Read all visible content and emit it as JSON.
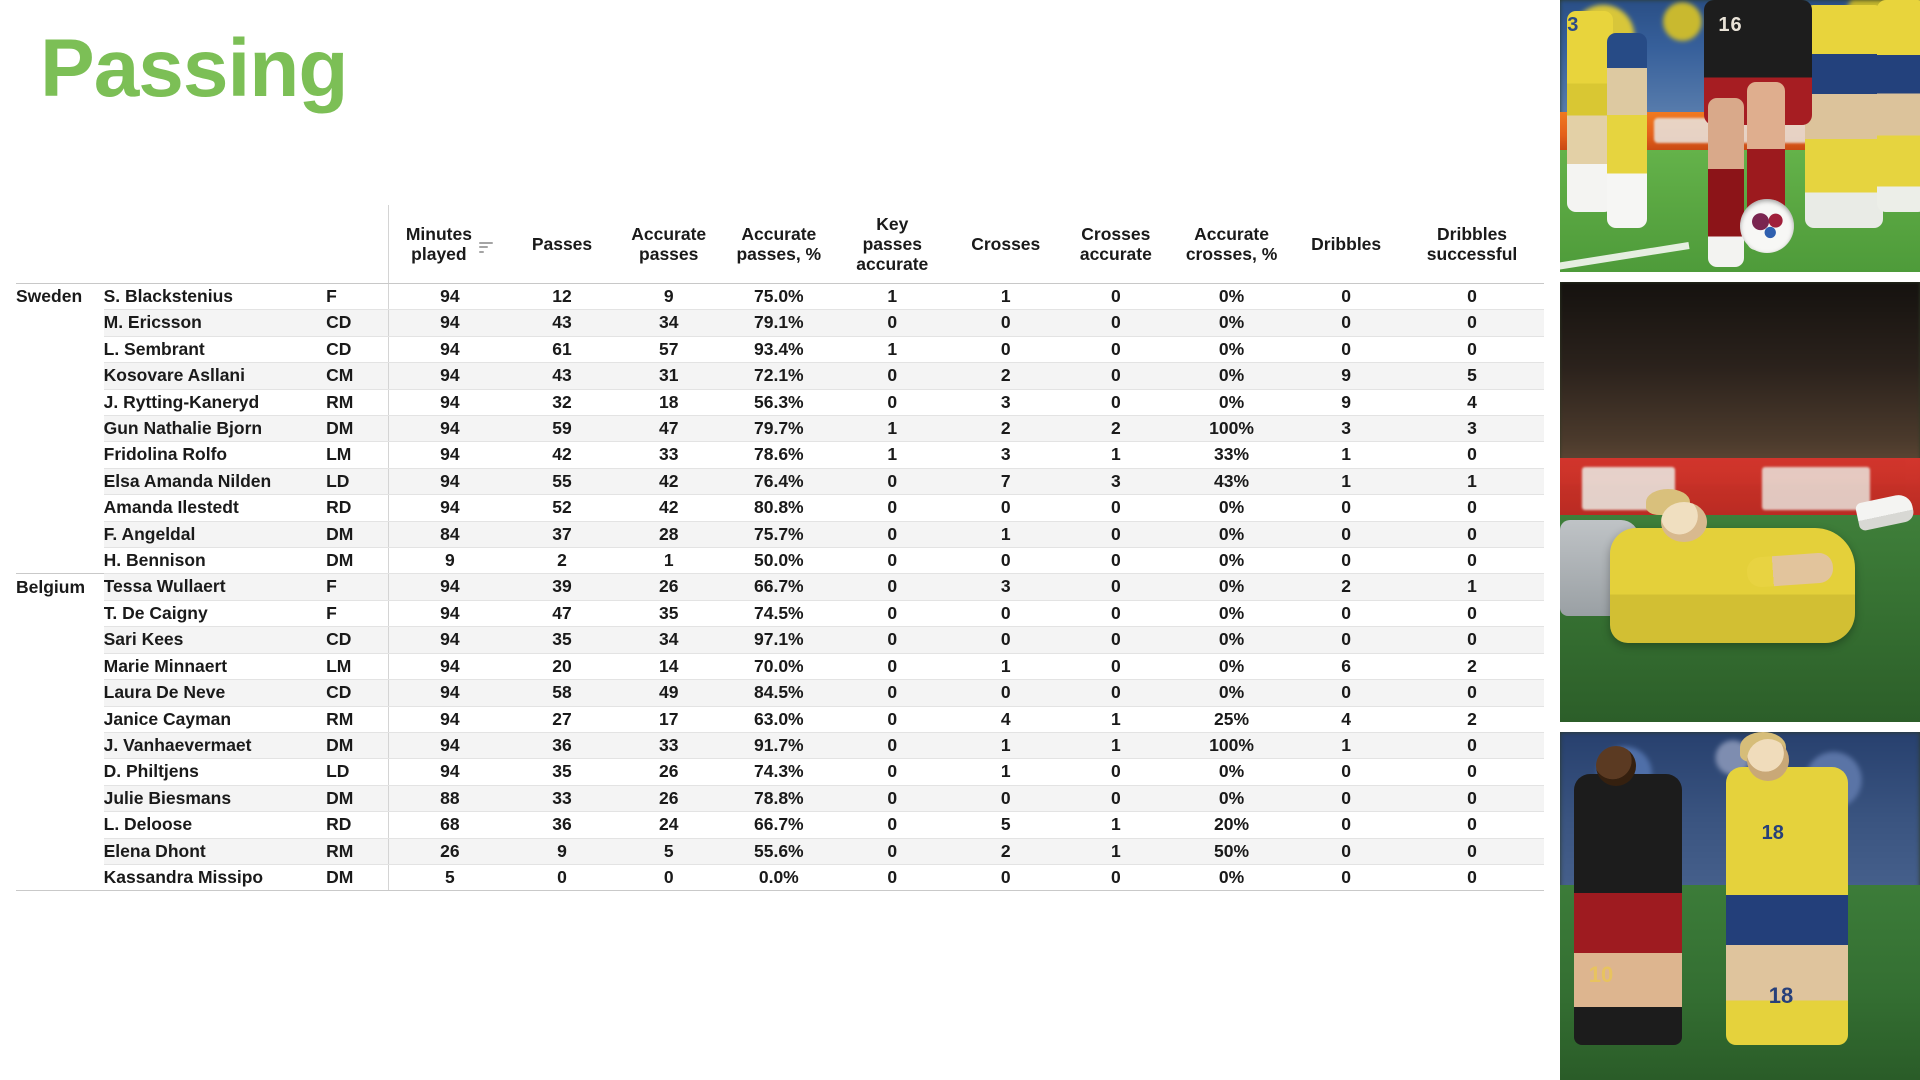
{
  "title": "Passing",
  "accent_color": "#7cbf56",
  "table": {
    "columns": [
      {
        "key": "team",
        "label": ""
      },
      {
        "key": "player",
        "label": ""
      },
      {
        "key": "pos",
        "label": ""
      },
      {
        "key": "minutes",
        "label": "Minutes played",
        "sort_icon": "sort-descending-icon",
        "sorted": true
      },
      {
        "key": "passes",
        "label": "Passes"
      },
      {
        "key": "acc",
        "label": "Accurate passes"
      },
      {
        "key": "accpct",
        "label": "Accurate passes, %"
      },
      {
        "key": "key",
        "label": "Key passes accurate"
      },
      {
        "key": "crosses",
        "label": "Crosses"
      },
      {
        "key": "crossacc",
        "label": "Crosses accurate"
      },
      {
        "key": "crosspct",
        "label": "Accurate crosses, %"
      },
      {
        "key": "dribbles",
        "label": "Dribbles"
      },
      {
        "key": "dribsucc",
        "label": "Dribbles successful"
      }
    ],
    "header_lines": {
      "minutes": [
        "Minutes",
        "played"
      ],
      "passes": [
        "Passes"
      ],
      "acc": [
        "Accurate",
        "passes"
      ],
      "accpct": [
        "Accurate",
        "passes, %"
      ],
      "key": [
        "Key",
        "passes",
        "accurate"
      ],
      "crosses": [
        "Crosses"
      ],
      "crossacc": [
        "Crosses",
        "accurate"
      ],
      "crosspct": [
        "Accurate",
        "crosses, %"
      ],
      "dribbles": [
        "Dribbles"
      ],
      "dribsucc": [
        "Dribbles",
        "successful"
      ]
    },
    "teams": [
      "Sweden",
      "Belgium"
    ],
    "rows": [
      {
        "team": "Sweden",
        "player": "S. Blackstenius",
        "pos": "F",
        "minutes": "94",
        "passes": "12",
        "acc": "9",
        "accpct": "75.0%",
        "key": "1",
        "crosses": "1",
        "crossacc": "0",
        "crosspct": "0%",
        "dribbles": "0",
        "dribsucc": "0"
      },
      {
        "team": "",
        "player": "M. Ericsson",
        "pos": "CD",
        "minutes": "94",
        "passes": "43",
        "acc": "34",
        "accpct": "79.1%",
        "key": "0",
        "crosses": "0",
        "crossacc": "0",
        "crosspct": "0%",
        "dribbles": "0",
        "dribsucc": "0"
      },
      {
        "team": "",
        "player": "L. Sembrant",
        "pos": "CD",
        "minutes": "94",
        "passes": "61",
        "acc": "57",
        "accpct": "93.4%",
        "key": "1",
        "crosses": "0",
        "crossacc": "0",
        "crosspct": "0%",
        "dribbles": "0",
        "dribsucc": "0"
      },
      {
        "team": "",
        "player": "Kosovare Asllani",
        "pos": "CM",
        "minutes": "94",
        "passes": "43",
        "acc": "31",
        "accpct": "72.1%",
        "key": "0",
        "crosses": "2",
        "crossacc": "0",
        "crosspct": "0%",
        "dribbles": "9",
        "dribsucc": "5"
      },
      {
        "team": "",
        "player": "J. Rytting-Kaneryd",
        "pos": "RM",
        "minutes": "94",
        "passes": "32",
        "acc": "18",
        "accpct": "56.3%",
        "key": "0",
        "crosses": "3",
        "crossacc": "0",
        "crosspct": "0%",
        "dribbles": "9",
        "dribsucc": "4"
      },
      {
        "team": "",
        "player": "Gun Nathalie Bjorn",
        "pos": "DM",
        "minutes": "94",
        "passes": "59",
        "acc": "47",
        "accpct": "79.7%",
        "key": "1",
        "crosses": "2",
        "crossacc": "2",
        "crosspct": "100%",
        "dribbles": "3",
        "dribsucc": "3"
      },
      {
        "team": "",
        "player": "Fridolina Rolfo",
        "pos": "LM",
        "minutes": "94",
        "passes": "42",
        "acc": "33",
        "accpct": "78.6%",
        "key": "1",
        "crosses": "3",
        "crossacc": "1",
        "crosspct": "33%",
        "dribbles": "1",
        "dribsucc": "0"
      },
      {
        "team": "",
        "player": "Elsa Amanda Nilden",
        "pos": "LD",
        "minutes": "94",
        "passes": "55",
        "acc": "42",
        "accpct": "76.4%",
        "key": "0",
        "crosses": "7",
        "crossacc": "3",
        "crosspct": "43%",
        "dribbles": "1",
        "dribsucc": "1"
      },
      {
        "team": "",
        "player": "Amanda Ilestedt",
        "pos": "RD",
        "minutes": "94",
        "passes": "52",
        "acc": "42",
        "accpct": "80.8%",
        "key": "0",
        "crosses": "0",
        "crossacc": "0",
        "crosspct": "0%",
        "dribbles": "0",
        "dribsucc": "0"
      },
      {
        "team": "",
        "player": "F. Angeldal",
        "pos": "DM",
        "minutes": "84",
        "passes": "37",
        "acc": "28",
        "accpct": "75.7%",
        "key": "0",
        "crosses": "1",
        "crossacc": "0",
        "crosspct": "0%",
        "dribbles": "0",
        "dribsucc": "0"
      },
      {
        "team": "",
        "player": "H. Bennison",
        "pos": "DM",
        "minutes": "9",
        "passes": "2",
        "acc": "1",
        "accpct": "50.0%",
        "key": "0",
        "crosses": "0",
        "crossacc": "0",
        "crosspct": "0%",
        "dribbles": "0",
        "dribsucc": "0"
      },
      {
        "team": "Belgium",
        "player": "Tessa Wullaert",
        "pos": "F",
        "minutes": "94",
        "passes": "39",
        "acc": "26",
        "accpct": "66.7%",
        "key": "0",
        "crosses": "3",
        "crossacc": "0",
        "crosspct": "0%",
        "dribbles": "2",
        "dribsucc": "1"
      },
      {
        "team": "",
        "player": "T. De Caigny",
        "pos": "F",
        "minutes": "94",
        "passes": "47",
        "acc": "35",
        "accpct": "74.5%",
        "key": "0",
        "crosses": "0",
        "crossacc": "0",
        "crosspct": "0%",
        "dribbles": "0",
        "dribsucc": "0"
      },
      {
        "team": "",
        "player": "Sari Kees",
        "pos": "CD",
        "minutes": "94",
        "passes": "35",
        "acc": "34",
        "accpct": "97.1%",
        "key": "0",
        "crosses": "0",
        "crossacc": "0",
        "crosspct": "0%",
        "dribbles": "0",
        "dribsucc": "0"
      },
      {
        "team": "",
        "player": "Marie Minnaert",
        "pos": "LM",
        "minutes": "94",
        "passes": "20",
        "acc": "14",
        "accpct": "70.0%",
        "key": "0",
        "crosses": "1",
        "crossacc": "0",
        "crosspct": "0%",
        "dribbles": "6",
        "dribsucc": "2"
      },
      {
        "team": "",
        "player": "Laura De Neve",
        "pos": "CD",
        "minutes": "94",
        "passes": "58",
        "acc": "49",
        "accpct": "84.5%",
        "key": "0",
        "crosses": "0",
        "crossacc": "0",
        "crosspct": "0%",
        "dribbles": "0",
        "dribsucc": "0"
      },
      {
        "team": "",
        "player": "Janice Cayman",
        "pos": "RM",
        "minutes": "94",
        "passes": "27",
        "acc": "17",
        "accpct": "63.0%",
        "key": "0",
        "crosses": "4",
        "crossacc": "1",
        "crosspct": "25%",
        "dribbles": "4",
        "dribsucc": "2"
      },
      {
        "team": "",
        "player": "J. Vanhaevermaet",
        "pos": "DM",
        "minutes": "94",
        "passes": "36",
        "acc": "33",
        "accpct": "91.7%",
        "key": "0",
        "crosses": "1",
        "crossacc": "1",
        "crosspct": "100%",
        "dribbles": "1",
        "dribsucc": "0"
      },
      {
        "team": "",
        "player": "D. Philtjens",
        "pos": "LD",
        "minutes": "94",
        "passes": "35",
        "acc": "26",
        "accpct": "74.3%",
        "key": "0",
        "crosses": "1",
        "crossacc": "0",
        "crosspct": "0%",
        "dribbles": "0",
        "dribsucc": "0"
      },
      {
        "team": "",
        "player": "Julie Biesmans",
        "pos": "DM",
        "minutes": "88",
        "passes": "33",
        "acc": "26",
        "accpct": "78.8%",
        "key": "0",
        "crosses": "0",
        "crossacc": "0",
        "crosspct": "0%",
        "dribbles": "0",
        "dribsucc": "0"
      },
      {
        "team": "",
        "player": "L. Deloose",
        "pos": "RD",
        "minutes": "68",
        "passes": "36",
        "acc": "24",
        "accpct": "66.7%",
        "key": "0",
        "crosses": "5",
        "crossacc": "1",
        "crosspct": "20%",
        "dribbles": "0",
        "dribsucc": "0"
      },
      {
        "team": "",
        "player": "Elena Dhont",
        "pos": "RM",
        "minutes": "26",
        "passes": "9",
        "acc": "5",
        "accpct": "55.6%",
        "key": "0",
        "crosses": "2",
        "crossacc": "1",
        "crosspct": "50%",
        "dribbles": "0",
        "dribsucc": "0"
      },
      {
        "team": "",
        "player": "Kassandra Missipo",
        "pos": "DM",
        "minutes": "5",
        "passes": "0",
        "acc": "0",
        "accpct": "0.0%",
        "key": "0",
        "crosses": "0",
        "crossacc": "0",
        "crosspct": "0%",
        "dribbles": "0",
        "dribsucc": "0"
      }
    ]
  },
  "photos": [
    {
      "name": "match-photo-ball-duel",
      "caption": ""
    },
    {
      "name": "match-photo-player-down",
      "caption": ""
    },
    {
      "name": "match-photo-running-duel",
      "caption": ""
    }
  ]
}
